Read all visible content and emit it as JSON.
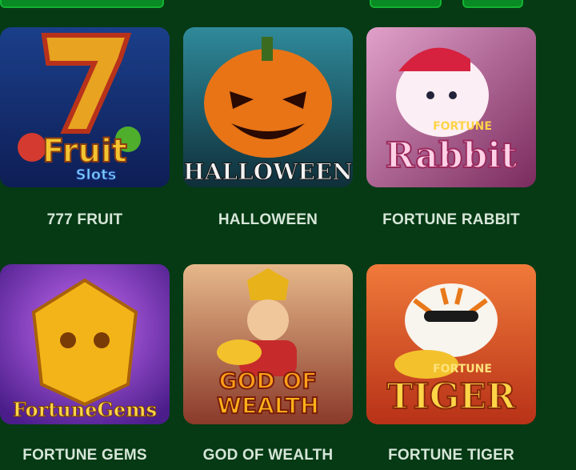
{
  "games": [
    {
      "name": "777 FRUIT",
      "art_text": [
        "Fruit",
        "Slots"
      ]
    },
    {
      "name": "HALLOWEEN",
      "art_text": [
        "HALLOWEEN"
      ]
    },
    {
      "name": "FORTUNE RABBIT",
      "art_text": [
        "FORTUNE",
        "Rabbit"
      ]
    },
    {
      "name": "FORTUNE GEMS",
      "art_text": [
        "FortuneGems"
      ]
    },
    {
      "name": "GOD OF WEALTH",
      "art_text": [
        "GOD OF",
        "WEALTH"
      ]
    },
    {
      "name": "FORTUNE TIGER",
      "art_text": [
        "FORTUNE",
        "TIGER"
      ]
    }
  ],
  "colors": {
    "background": "#053a14",
    "accent": "#0a8a25"
  }
}
